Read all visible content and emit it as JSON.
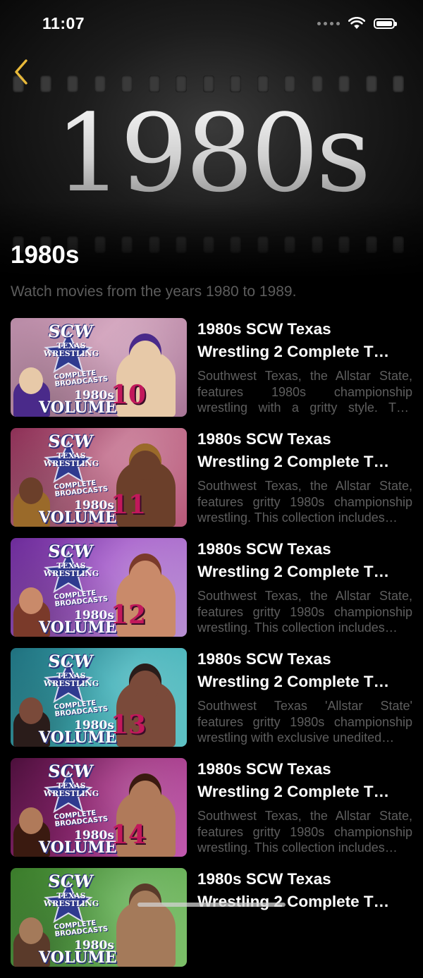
{
  "status_bar": {
    "time": "11:07"
  },
  "hero": {
    "title": "1980s"
  },
  "page": {
    "title": "1980s",
    "subtitle": "Watch movies from the years 1980 to 1989."
  },
  "thumbnail_art": {
    "brand": "SCW",
    "line_texas": "TEXAS",
    "line_wrestling": "WRESTLING",
    "line_complete": "COMPLETE",
    "line_broadcasts": "BROADCASTS",
    "year": "1980s",
    "volume_label": "VOLUME"
  },
  "movies": [
    {
      "title_line1": "1980s SCW Texas",
      "title_line2": "Wrestling 2 Complete T…",
      "description": "Southwest Texas, the Allstar State, features 1980s championship wrestling with a gritty style. This collection includes…",
      "volume_number": "10",
      "theme": "pink"
    },
    {
      "title_line1": "1980s SCW Texas",
      "title_line2": "Wrestling 2 Complete T…",
      "description": "Southwest Texas, the Allstar State, features gritty 1980s championship wrestling. This collection includes…",
      "volume_number": "11",
      "theme": "rose"
    },
    {
      "title_line1": "1980s SCW Texas",
      "title_line2": "Wrestling 2 Complete T…",
      "description": "Southwest Texas, the Allstar State, features gritty 1980s championship wrestling. This collection includes…",
      "volume_number": "12",
      "theme": "purple"
    },
    {
      "title_line1": "1980s SCW Texas",
      "title_line2": "Wrestling 2 Complete T…",
      "description": "Southwest Texas 'Allstar State' features gritty 1980s championship wrestling with exclusive unedited…",
      "volume_number": "13",
      "theme": "teal"
    },
    {
      "title_line1": "1980s SCW Texas",
      "title_line2": "Wrestling 2 Complete T…",
      "description": "Southwest Texas, the Allstar State, features gritty 1980s championship wrestling. This collection includes…",
      "volume_number": "14",
      "theme": "magenta"
    },
    {
      "title_line1": "1980s SCW Texas",
      "title_line2": "Wrestling 2 Complete T…",
      "description": "",
      "volume_number": "",
      "theme": "green"
    }
  ],
  "colors": {
    "background": "#000000",
    "accent_back": "#e8b93a",
    "title_text": "#ffffff",
    "secondary_text": "#5e5e5e"
  },
  "icons": {
    "back": "chevron-left-icon",
    "wifi": "wifi-icon",
    "battery": "battery-icon",
    "signal": "signal-icon"
  }
}
